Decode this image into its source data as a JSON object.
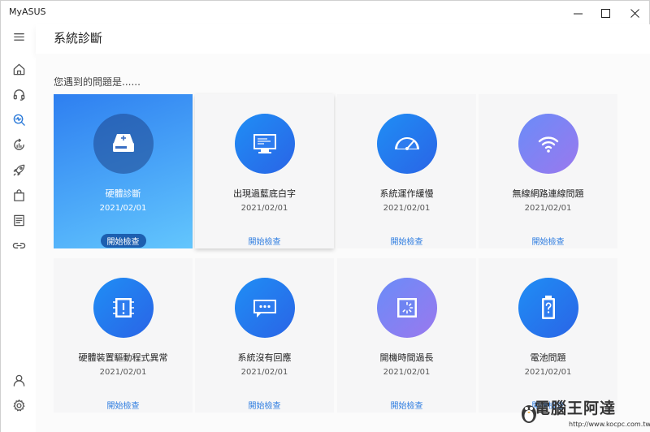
{
  "window": {
    "title": "MyASUS"
  },
  "header": {
    "title": "系統診斷"
  },
  "main": {
    "question": "您遇到的問題是......"
  },
  "cards": [
    {
      "label": "硬體診斷",
      "date": "2021/02/01",
      "action": "開始檢查",
      "icon": "drive-icon"
    },
    {
      "label": "出現過藍底白字",
      "date": "2021/02/01",
      "action": "開始檢查",
      "icon": "monitor-icon"
    },
    {
      "label": "系統運作緩慢",
      "date": "2021/02/01",
      "action": "開始檢查",
      "icon": "speedometer-icon"
    },
    {
      "label": "無線網路連線問題",
      "date": "2021/02/01",
      "action": "開始檢查",
      "icon": "wifi-icon"
    },
    {
      "label": "硬體裝置驅動程式異常",
      "date": "2021/02/01",
      "action": "開始檢查",
      "icon": "chip-alert-icon"
    },
    {
      "label": "系統沒有回應",
      "date": "2021/02/01",
      "action": "開始檢查",
      "icon": "chat-bubble-icon"
    },
    {
      "label": "開機時間過長",
      "date": "2021/02/01",
      "action": "開始檢查",
      "icon": "loading-window-icon"
    },
    {
      "label": "電池問題",
      "date": "2021/02/01",
      "action": "開始檢查",
      "icon": "battery-question-icon"
    }
  ],
  "watermark": {
    "text": "電腦王阿達",
    "url": "http://www.kocpc.com.tw"
  },
  "colors": {
    "accent": "#2f7de0",
    "selected_card_start": "#2e7ff0",
    "selected_card_end": "#63c6fd"
  }
}
